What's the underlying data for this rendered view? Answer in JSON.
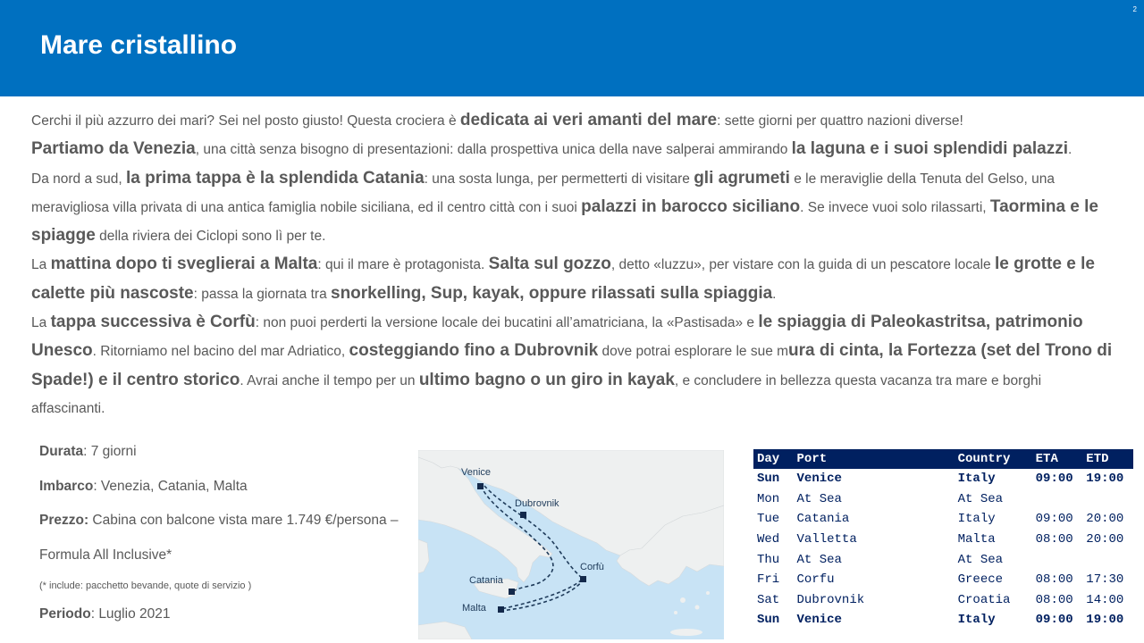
{
  "slide": {
    "title": "Mare cristallino",
    "number": "2"
  },
  "intro": [
    {
      "t": "Cerchi il più azzurro dei mari? Sei nel posto giusto! Questa crociera è ",
      "b": false
    },
    {
      "t": "dedicata ai veri amanti del mare",
      "b": true
    },
    {
      "t": ": sette giorni per quattro nazioni diverse!",
      "b": false
    }
  ],
  "para1": [
    {
      "t": "Partiamo da Venezia",
      "b": true
    },
    {
      "t": ", una città senza bisogno di presentazioni: dalla prospettiva unica della nave salperai ammirando ",
      "b": false
    },
    {
      "t": "la laguna e i suoi splendidi palazzi",
      "b": true
    },
    {
      "t": ".",
      "b": false
    }
  ],
  "para2": [
    {
      "t": "Da nord a sud, ",
      "b": false
    },
    {
      "t": "la prima tappa è la splendida Catania",
      "b": true
    },
    {
      "t": ": una sosta lunga, per permetterti di visitare ",
      "b": false
    },
    {
      "t": "gli agrumeti",
      "b": true
    },
    {
      "t": " e le meraviglie della Tenuta del Gelso, una meravigliosa villa privata di una antica famiglia nobile siciliana, ed il centro città con i suoi ",
      "b": false
    },
    {
      "t": "palazzi in barocco siciliano",
      "b": true
    },
    {
      "t": ". Se invece vuoi solo rilassarti, ",
      "b": false
    },
    {
      "t": "Taormina e le spiagge",
      "b": true
    },
    {
      "t": " della riviera dei Ciclopi sono lì per te.",
      "b": false
    }
  ],
  "para3": [
    {
      "t": "La ",
      "b": false
    },
    {
      "t": "mattina dopo ti sveglierai a Malta",
      "b": true
    },
    {
      "t": ": qui il mare è protagonista. ",
      "b": false
    },
    {
      "t": "Salta sul gozzo",
      "b": true
    },
    {
      "t": ", detto «luzzu», per vistare con la guida di un pescatore locale ",
      "b": false
    },
    {
      "t": "le grotte e le calette più nascoste",
      "b": true
    },
    {
      "t": ": passa la giornata tra ",
      "b": false
    },
    {
      "t": "snorkelling, Sup, kayak, oppure rilassati sulla spiaggia",
      "b": true
    },
    {
      "t": ".",
      "b": false
    }
  ],
  "para4": [
    {
      "t": "La ",
      "b": false
    },
    {
      "t": "tappa successiva è Corfù",
      "b": true
    },
    {
      "t": ": non puoi perderti la versione locale dei bucatini all’amatriciana, la «Pastisada» e ",
      "b": false
    },
    {
      "t": "le spiaggia di Paleokastritsa, patrimonio Unesco",
      "b": true
    },
    {
      "t": ". Ritorniamo nel bacino del mar Adriatico, ",
      "b": false
    },
    {
      "t": "costeggiando fino a Dubrovnik",
      "b": true
    },
    {
      "t": " dove potrai esplorare le sue m",
      "b": false
    },
    {
      "t": "ura di cinta, la Fortezza (set del Trono di Spade!) e il centro storico",
      "b": true
    },
    {
      "t": ". Avrai anche il tempo per un ",
      "b": false
    },
    {
      "t": "ultimo bagno o un giro in kayak",
      "b": true
    },
    {
      "t": ", e concludere in bellezza questa vacanza tra mare e borghi affascinanti.",
      "b": false
    }
  ],
  "info": {
    "durata_label": "Durata",
    "durata_value": ": 7 giorni",
    "imbarco_label": "Imbarco",
    "imbarco_value": ": Venezia, Catania, Malta",
    "prezzo_label": "Prezzo:",
    "prezzo_value": " Cabina con balcone vista mare 1.749 €/persona –",
    "formula": "Formula All Inclusive*",
    "note": "(* include: pacchetto bevande, quote di servizio )",
    "periodo_label": "Periodo",
    "periodo_value": ": Luglio 2021"
  },
  "map": {
    "labels": {
      "venice": "Venice",
      "dubrovnik": "Dubrovnik",
      "corfu": "Corfù",
      "catania": "Catania",
      "malta": "Malta"
    },
    "colors": {
      "sea": "#c8e3f5",
      "land": "#eef0f0",
      "route": "#1f3b5a",
      "marker": "#13294b"
    }
  },
  "itinerary": {
    "headers": {
      "day": "Day",
      "port": "Port",
      "country": "Country",
      "eta": "ETA",
      "etd": "ETD"
    },
    "rows": [
      {
        "day": "Sun",
        "port": "Venice",
        "country": "Italy",
        "eta": "09:00",
        "etd": "19:00",
        "bold": true
      },
      {
        "day": "Mon",
        "port": "At Sea",
        "country": "At Sea",
        "eta": "",
        "etd": "",
        "bold": false
      },
      {
        "day": "Tue",
        "port": "Catania",
        "country": "Italy",
        "eta": "09:00",
        "etd": "20:00",
        "bold": false
      },
      {
        "day": "Wed",
        "port": "Valletta",
        "country": "Malta",
        "eta": "08:00",
        "etd": "20:00",
        "bold": false
      },
      {
        "day": "Thu",
        "port": "At Sea",
        "country": "At Sea",
        "eta": "",
        "etd": "",
        "bold": false
      },
      {
        "day": "Fri",
        "port": "Corfu",
        "country": "Greece",
        "eta": "08:00",
        "etd": "17:30",
        "bold": false
      },
      {
        "day": "Sat",
        "port": "Dubrovnik",
        "country": "Croatia",
        "eta": "08:00",
        "etd": "14:00",
        "bold": false
      },
      {
        "day": "Sun",
        "port": "Venice",
        "country": "Italy",
        "eta": "09:00",
        "etd": "19:00",
        "bold": true
      }
    ],
    "colors": {
      "header_bg": "#002060",
      "text": "#002060"
    }
  }
}
